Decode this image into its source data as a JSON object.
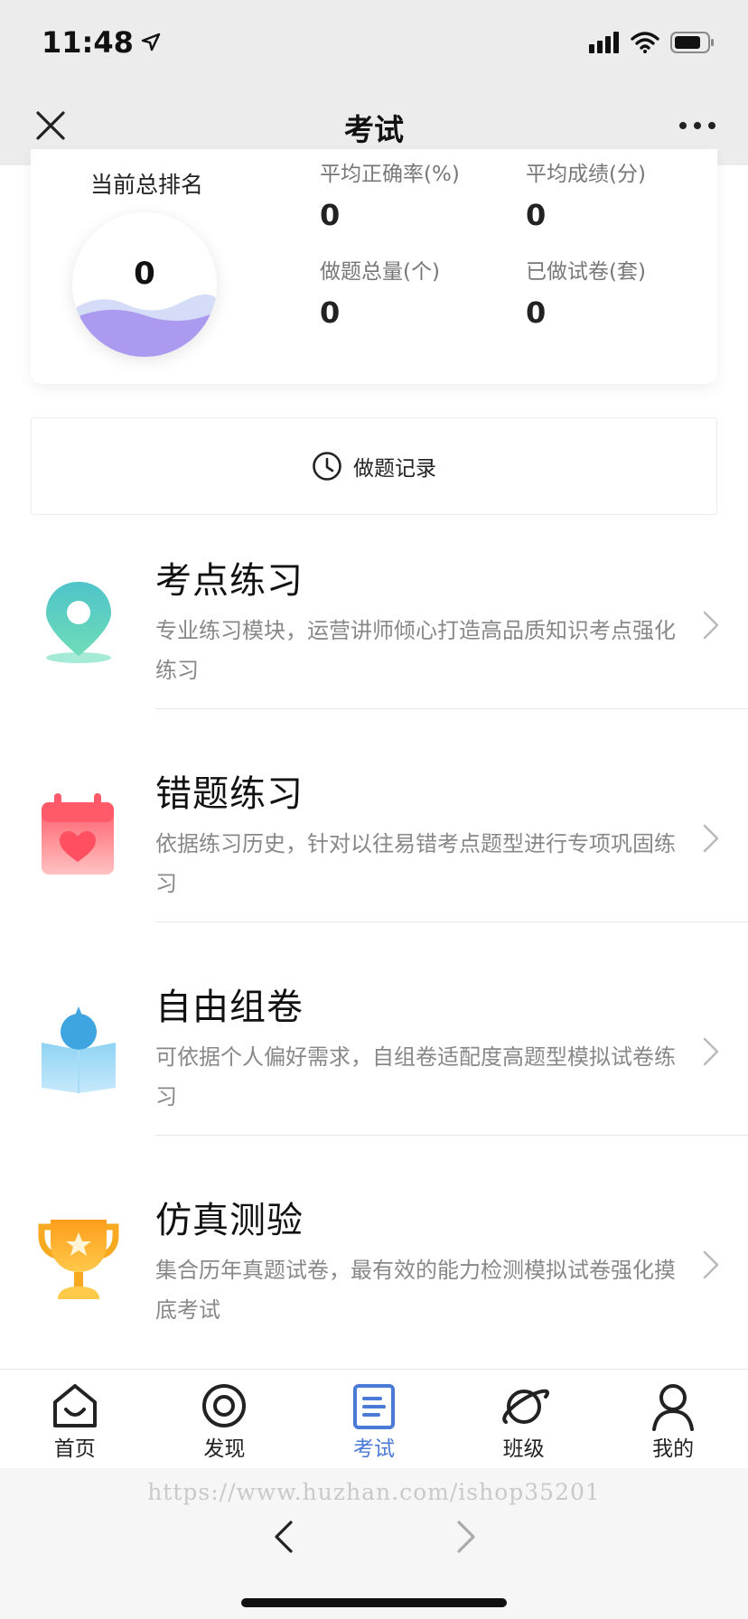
{
  "status_bar": {
    "time": "11:48",
    "icons": [
      "location-arrow-icon",
      "cellular-signal-icon",
      "wifi-icon",
      "battery-icon"
    ]
  },
  "nav": {
    "title": "考试",
    "close_icon": "close-icon",
    "more_icon": "more-icon"
  },
  "stats": {
    "rank_label": "当前总排名",
    "rank_value": "0",
    "items": [
      {
        "label": "平均正确率(%)",
        "value": "0"
      },
      {
        "label": "平均成绩(分)",
        "value": "0"
      },
      {
        "label": "做题总量(个)",
        "value": "0"
      },
      {
        "label": "已做试卷(套)",
        "value": "0"
      }
    ]
  },
  "record": {
    "label": "做题记录",
    "icon": "clock-icon"
  },
  "features": [
    {
      "title": "考点练习",
      "desc": "专业练习模块，运营讲师倾心打造高品质知识考点强化练习",
      "icon": "location-pin-icon"
    },
    {
      "title": "错题练习",
      "desc": "依据练习历史，针对以往易错考点题型进行专项巩固练习",
      "icon": "calendar-heart-icon"
    },
    {
      "title": "自由组卷",
      "desc": "可依据个人偏好需求，自组卷适配度高题型模拟试卷练习",
      "icon": "reader-book-icon"
    },
    {
      "title": "仿真测验",
      "desc": "集合历年真题试卷，最有效的能力检测模拟试卷强化摸底考试",
      "icon": "trophy-icon"
    }
  ],
  "tabs": [
    {
      "label": "首页",
      "icon": "home-icon",
      "active": false
    },
    {
      "label": "发现",
      "icon": "discover-icon",
      "active": false
    },
    {
      "label": "考试",
      "icon": "exam-icon",
      "active": true
    },
    {
      "label": "班级",
      "icon": "planet-icon",
      "active": false
    },
    {
      "label": "我的",
      "icon": "user-icon",
      "active": false
    }
  ],
  "footer": {
    "watermark": "https://www.huzhan.com/ishop35201"
  },
  "colors": {
    "accent": "#4a7ad6",
    "wave": "#a48ef0",
    "pin": "#5fd3c6",
    "calendar": "#ff6b7a",
    "reader": "#6cc3ee",
    "trophy": "#f7a91f"
  }
}
